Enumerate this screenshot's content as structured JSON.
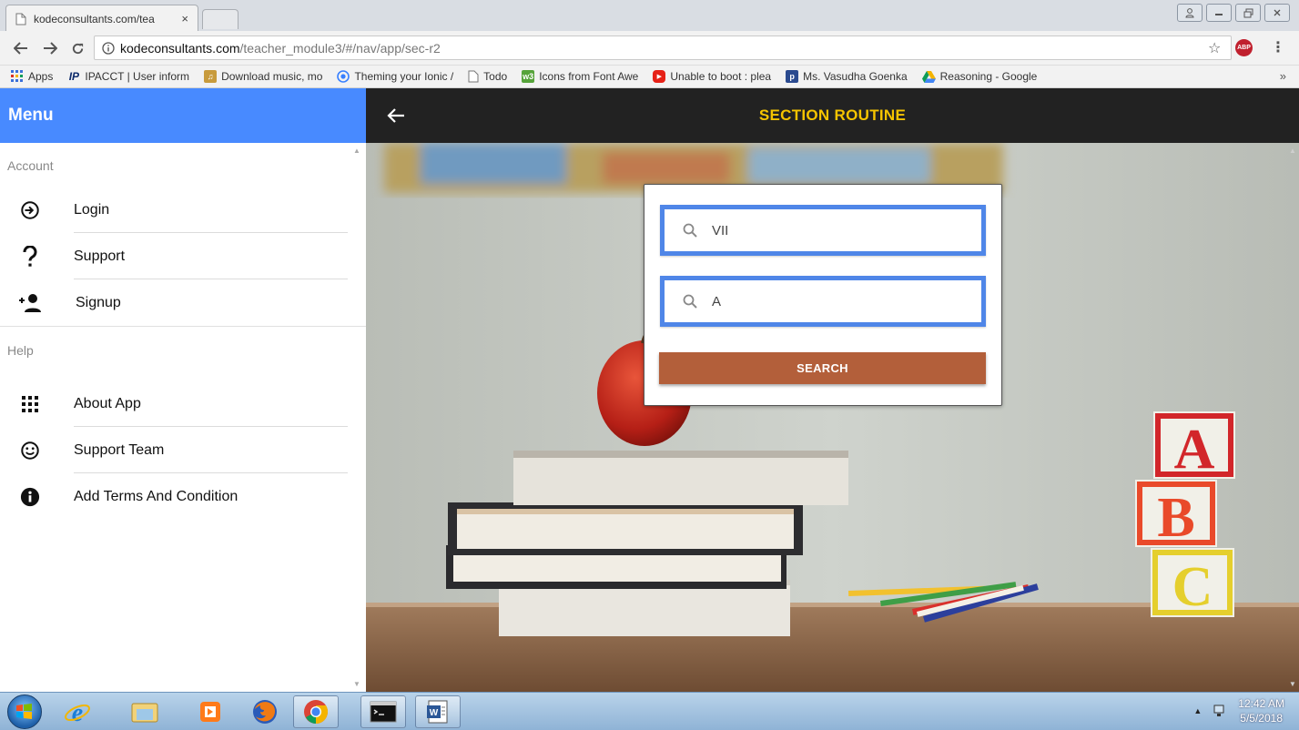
{
  "browser": {
    "tab_title": "kodeconsultants.com/tea",
    "tab_close": "×",
    "url_host": "kodeconsultants.com",
    "url_path": "/teacher_module3/#/nav/app/sec-r2",
    "abp_label": "ABP"
  },
  "bookmarks": [
    {
      "label": "Apps",
      "icon": "apps-grid-icon"
    },
    {
      "label": "IPACCT | User inform",
      "icon": "ip-logo-icon"
    },
    {
      "label": "Download music, mo",
      "icon": "music-icon"
    },
    {
      "label": "Theming your Ionic /",
      "icon": "ionic-icon"
    },
    {
      "label": "Todo",
      "icon": "page-icon"
    },
    {
      "label": "Icons from Font Awe",
      "icon": "font-awesome-icon"
    },
    {
      "label": "Unable to boot : plea",
      "icon": "youtube-icon"
    },
    {
      "label": "Ms. Vasudha Goenka",
      "icon": "p-icon"
    },
    {
      "label": "Reasoning - Google",
      "icon": "google-drive-icon"
    }
  ],
  "bookmarks_overflow": "»",
  "menu": {
    "title": "Menu",
    "sections": [
      {
        "heading": "Account",
        "items": [
          {
            "label": "Login",
            "icon": "login-icon"
          },
          {
            "label": "Support",
            "icon": "question-icon"
          },
          {
            "label": "Signup",
            "icon": "person-add-icon"
          }
        ]
      },
      {
        "heading": "Help",
        "items": [
          {
            "label": "About App",
            "icon": "apps-icon"
          },
          {
            "label": "Support Team",
            "icon": "smiley-icon"
          },
          {
            "label": "Add Terms And Condition",
            "icon": "info-icon"
          }
        ]
      }
    ]
  },
  "page": {
    "title": "SECTION ROUTINE"
  },
  "search": {
    "class_value": "VII",
    "section_value": "A",
    "button_label": "SEARCH"
  },
  "taskbar": {
    "time": "12:42 AM",
    "date": "5/5/2018"
  },
  "colors": {
    "menu_header": "#488aff",
    "toolbar": "#222222",
    "title": "#f5c400",
    "field_border": "#4f86e8",
    "search_button": "#b35f3a"
  }
}
